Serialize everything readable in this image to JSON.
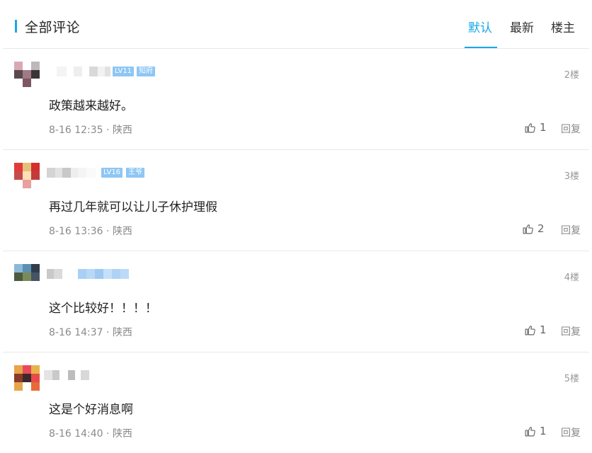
{
  "header": {
    "title": "全部评论",
    "tabs": [
      {
        "label": "默认",
        "active": true
      },
      {
        "label": "最新",
        "active": false
      },
      {
        "label": "楼主",
        "active": false
      }
    ]
  },
  "colors": {
    "accent": "#1aa7e8",
    "badge": "#8ec6f5"
  },
  "comments": [
    {
      "level_badge": "LV11",
      "title_badge": "知府",
      "floor": "2楼",
      "text": "政策越来越好。",
      "time": "8-16 12:35",
      "location": "陕西",
      "likes": "1",
      "reply_label": "回复",
      "avatar_colors": [
        "#d8a9b3",
        "#ffffff",
        "#bfb7b9",
        "#5a4a4e",
        "#a07a86",
        "#3b3437",
        "#ffffff",
        "#7d5662",
        "#ffffff"
      ]
    },
    {
      "level_badge": "LV16",
      "title_badge": "王爷",
      "floor": "3楼",
      "text": "再过几年就可以让儿子休护理假",
      "time": "8-16 13:36",
      "location": "陕西",
      "likes": "2",
      "reply_label": "回复",
      "avatar_colors": [
        "#e23a3a",
        "#e6c07a",
        "#d32f2f",
        "#c44b4b",
        "#ffe0b5",
        "#c23b3b",
        "#ffffff",
        "#e8a0a0",
        "#ffffff"
      ]
    },
    {
      "level_badge": "",
      "title_badge": "",
      "floor": "4楼",
      "text": "这个比较好！！！！",
      "time": "8-16 14:37",
      "location": "陕西",
      "likes": "1",
      "reply_label": "回复",
      "avatar_colors": [
        "#8cb9d8",
        "#5d8fb0",
        "#2f3d4a",
        "#4c5a3e",
        "#7a8a5a",
        "#445566",
        "#ffffff",
        "#ffffff",
        "#ffffff"
      ]
    },
    {
      "level_badge": "",
      "title_badge": "",
      "floor": "5楼",
      "text": "这是个好消息啊",
      "time": "8-16 14:40",
      "location": "陕西",
      "likes": "1",
      "reply_label": "回复",
      "avatar_colors": [
        "#e8a44a",
        "#e84a5a",
        "#e8b24a",
        "#8a3a2a",
        "#3a2a2a",
        "#e84a4a",
        "#e8a44a",
        "#ffffff",
        "#e86a3a"
      ]
    }
  ]
}
